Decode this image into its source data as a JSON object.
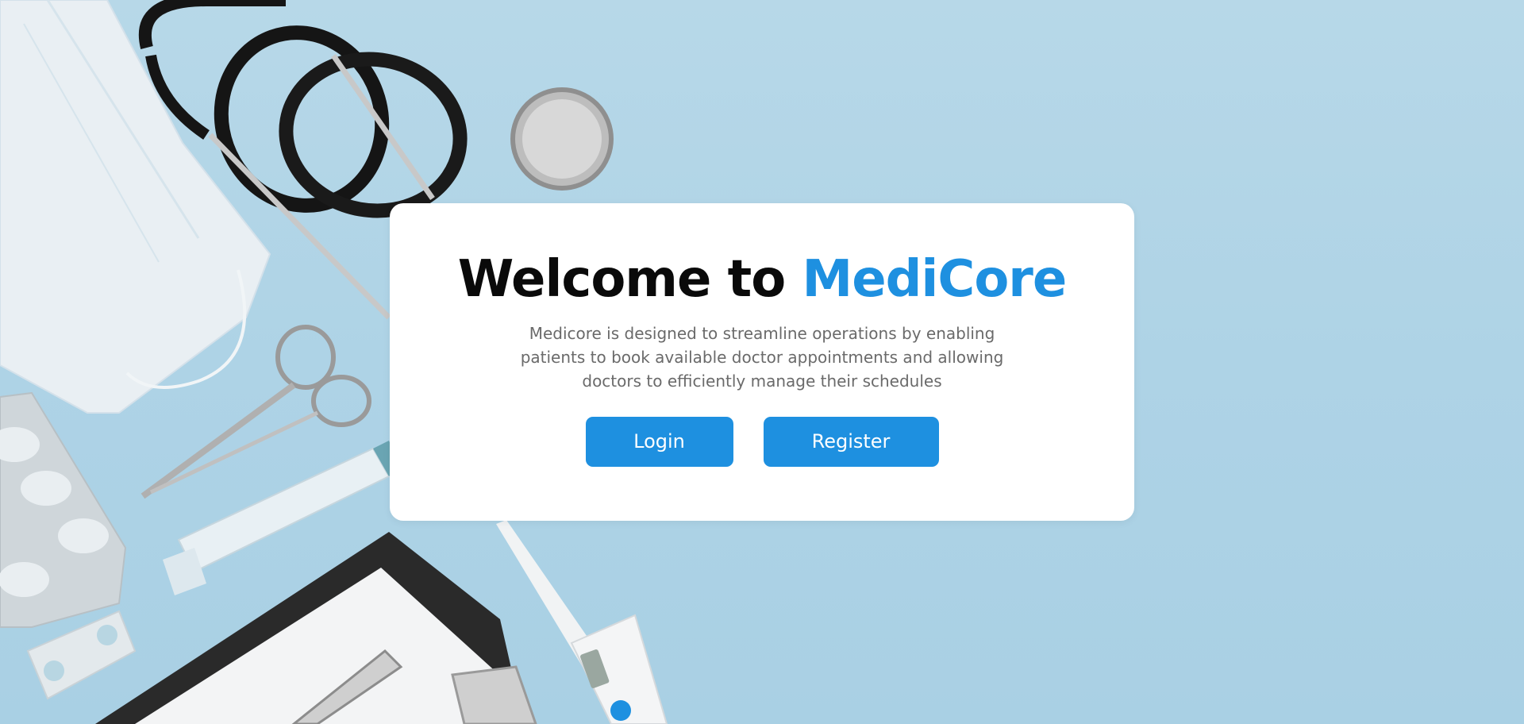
{
  "welcome": {
    "title_prefix": "Welcome to ",
    "title_brand": "MediCore",
    "description": "Medicore is designed to streamline operations by enabling patients to book available doctor appointments and allowing doctors to efficiently manage their schedules"
  },
  "actions": {
    "login_label": "Login",
    "register_label": "Register"
  },
  "colors": {
    "accent": "#1e90e0",
    "background": "#b0d5e8",
    "card": "#ffffff"
  },
  "background_image": {
    "items": [
      "surgical-mask-icon",
      "stethoscope-icon",
      "scissors-icon",
      "syringe-icon",
      "pill-blister-icon",
      "clipboard-icon",
      "pen-icon",
      "thermometer-icon"
    ]
  }
}
